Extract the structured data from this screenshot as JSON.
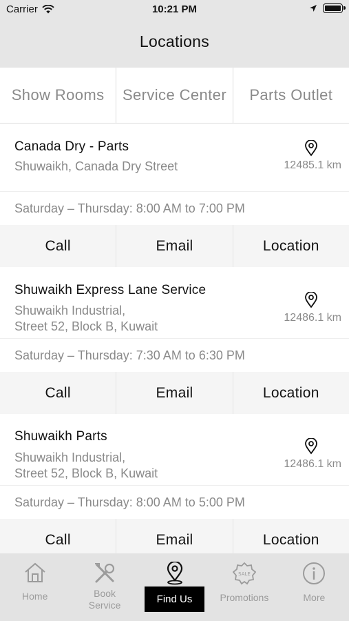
{
  "status_bar": {
    "carrier": "Carrier",
    "time": "10:21 PM"
  },
  "nav": {
    "title": "Locations"
  },
  "tabs": [
    {
      "label": "Show Rooms"
    },
    {
      "label": "Service Center"
    },
    {
      "label": "Parts Outlet"
    }
  ],
  "locations": [
    {
      "name": "Canada Dry - Parts",
      "address": "Shuwaikh, Canada Dry Street",
      "distance": "12485.1 km",
      "hours": "Saturday – Thursday: 8:00 AM to 7:00 PM",
      "call": "Call",
      "email": "Email",
      "location": "Location"
    },
    {
      "name": "Shuwaikh Express Lane Service",
      "address_line1": "Shuwaikh Industrial,",
      "address_line2": "Street 52, Block B, Kuwait",
      "distance": "12486.1 km",
      "hours": "Saturday – Thursday: 7:30 AM to 6:30 PM",
      "call": "Call",
      "email": "Email",
      "location": "Location"
    },
    {
      "name": "Shuwaikh Parts",
      "address_line1": "Shuwaikh Industrial,",
      "address_line2": "Street 52, Block B, Kuwait",
      "distance": "12486.1 km",
      "hours": "Saturday – Thursday: 8:00 AM to 5:00 PM",
      "call": "Call",
      "email": "Email",
      "location": "Location"
    }
  ],
  "tabbar": {
    "home": "Home",
    "book_line1": "Book",
    "book_line2": "Service",
    "find": "Find Us",
    "promotions": "Promotions",
    "more": "More"
  },
  "colors": {
    "active_tab_bg": "#000000",
    "muted_text": "#8a8a8a",
    "bar_bg": "#e3e3e3"
  }
}
